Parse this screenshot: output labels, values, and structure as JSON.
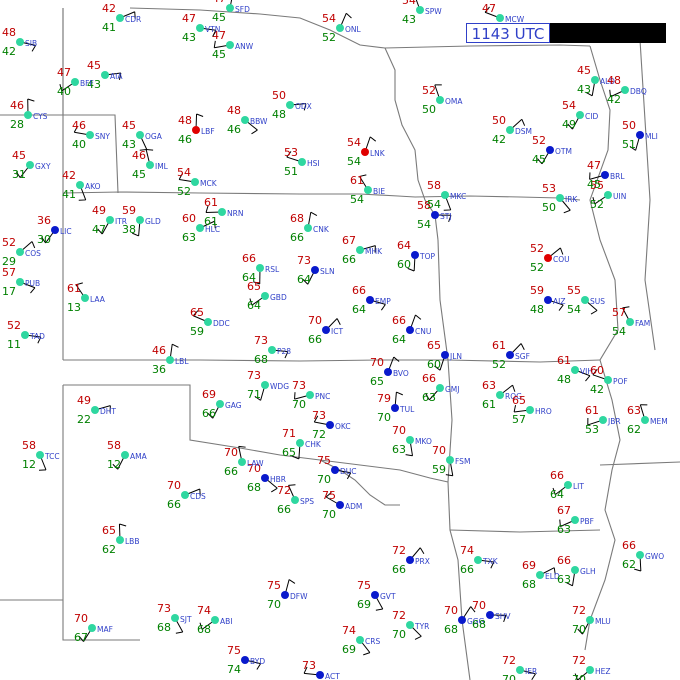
{
  "title_box": {
    "time": "1143 UTC"
  },
  "colors": {
    "temperature": "#c00000",
    "dewpoint": "#008000",
    "station_id": "#3040c8",
    "weather_symbol": "#b000b0",
    "borders": "#7a7a7a",
    "wind_barb": "#000000",
    "sky_clear": "#2fd7a0",
    "sky_overcast": "#0a1acc",
    "sky_thunder": "#e00000"
  },
  "stations": [
    {
      "id": "CDR",
      "t": "42",
      "td": "41",
      "sky": "clear"
    },
    {
      "id": "SFD",
      "t": "47",
      "td": "45",
      "sky": "clear"
    },
    {
      "id": "ANW",
      "t": "47",
      "td": "45",
      "sky": "clear"
    },
    {
      "id": "VTN",
      "t": "47",
      "td": "43",
      "sky": "clear"
    },
    {
      "id": "ONL",
      "t": "54",
      "td": "52",
      "sky": "clear"
    },
    {
      "id": "SIB",
      "t": "48",
      "td": "42",
      "sky": "clear"
    },
    {
      "id": "AIA",
      "t": "45",
      "td": "43",
      "sky": "clear"
    },
    {
      "id": "BFF",
      "t": "47",
      "td": "40",
      "sky": "clear"
    },
    {
      "id": "CYS",
      "t": "46",
      "td": "28",
      "sky": "clear"
    },
    {
      "id": "SNY",
      "t": "46",
      "td": "40",
      "sky": "clear"
    },
    {
      "id": "OGA",
      "t": "45",
      "td": "43",
      "sky": "clear"
    },
    {
      "id": "LBF",
      "t": "48",
      "td": "46",
      "sky": "thunder"
    },
    {
      "id": "BBW",
      "t": "48",
      "td": "46",
      "sky": "clear"
    },
    {
      "id": "ODX",
      "t": "50",
      "td": "48",
      "sky": "clear"
    },
    {
      "id": "IML",
      "t": "46",
      "td": "45",
      "sky": "clear"
    },
    {
      "id": "HSI",
      "t": "53",
      "td": "51",
      "sky": "clear"
    },
    {
      "id": "LNK",
      "t": "54",
      "td": "54",
      "sky": "thunder"
    },
    {
      "id": "GXY",
      "t": "45",
      "td": "31",
      "sky": "clear"
    },
    {
      "id": "MCK",
      "t": "54",
      "td": "52",
      "sky": "clear"
    },
    {
      "id": "AKO",
      "t": "42",
      "td": "41",
      "sky": "clear"
    },
    {
      "id": "LIC",
      "t": "36",
      "td": "30",
      "sky": "overcast"
    },
    {
      "id": "ITR",
      "t": "49",
      "td": "47",
      "sky": "clear"
    },
    {
      "id": "GLD",
      "t": "59",
      "td": "38",
      "sky": "clear"
    },
    {
      "id": "HLC",
      "t": "60",
      "td": "63",
      "sky": "clear"
    },
    {
      "id": "NRN",
      "t": "61",
      "td": "61",
      "sky": "clear"
    },
    {
      "id": "BIE",
      "t": "61",
      "td": "54",
      "sky": "clear"
    },
    {
      "id": "CNK",
      "t": "68",
      "td": "66",
      "sky": "clear"
    },
    {
      "id": "MHK",
      "t": "67",
      "td": "66",
      "sky": "clear"
    },
    {
      "id": "TOP",
      "t": "64",
      "td": "60",
      "sky": "overcast"
    },
    {
      "id": "STJ",
      "t": "58",
      "td": "54",
      "sky": "overcast"
    },
    {
      "id": "COS",
      "t": "52",
      "td": "29",
      "sky": "clear"
    },
    {
      "id": "PUB",
      "t": "57",
      "td": "17",
      "sky": "clear"
    },
    {
      "id": "LAA",
      "t": "61",
      "td": "13",
      "sky": "clear"
    },
    {
      "id": "TAD",
      "t": "52",
      "td": "11",
      "sky": "clear"
    },
    {
      "id": "SLN",
      "t": "73",
      "td": "64",
      "sky": "overcast"
    },
    {
      "id": "RSL",
      "t": "66",
      "td": "64",
      "sky": "clear"
    },
    {
      "id": "GBD",
      "t": "65",
      "td": "64",
      "sky": "clear"
    },
    {
      "id": "DDC",
      "t": "65",
      "td": "59",
      "sky": "clear"
    },
    {
      "id": "EMP",
      "t": "66",
      "td": "64",
      "sky": "overcast"
    },
    {
      "id": "ICT",
      "t": "70",
      "td": "66",
      "sky": "overcast"
    },
    {
      "id": "CNU",
      "t": "66",
      "td": "64",
      "sky": "overcast"
    },
    {
      "id": "LBL",
      "t": "46",
      "td": "36",
      "sky": "clear"
    },
    {
      "id": "P28",
      "t": "73",
      "td": "68",
      "sky": "clear"
    },
    {
      "id": "JLN",
      "t": "65",
      "td": "60",
      "sky": "overcast"
    },
    {
      "id": "SGF",
      "t": "61",
      "td": "52",
      "sky": "overcast"
    },
    {
      "id": "VIH",
      "t": "61",
      "td": "48",
      "sky": "clear"
    },
    {
      "id": "DHT",
      "t": "49",
      "td": "22",
      "sky": "clear"
    },
    {
      "id": "GAG",
      "t": "69",
      "td": "66",
      "sky": "clear"
    },
    {
      "id": "WDG",
      "t": "73",
      "td": "71",
      "sky": "clear"
    },
    {
      "id": "PNC",
      "t": "73",
      "td": "70",
      "sky": "clear"
    },
    {
      "id": "BVO",
      "t": "70",
      "td": "65",
      "sky": "overcast"
    },
    {
      "id": "GMJ",
      "t": "66",
      "td": "63",
      "sky": "clear"
    },
    {
      "id": "TUL",
      "t": "79",
      "td": "70",
      "sky": "overcast"
    },
    {
      "id": "OKC",
      "t": "73",
      "td": "72",
      "sky": "overcast"
    },
    {
      "id": "HBR",
      "t": "70",
      "td": "68",
      "sky": "overcast"
    },
    {
      "id": "MKO",
      "t": "70",
      "td": "63",
      "sky": "clear"
    },
    {
      "id": "FSM",
      "t": "70",
      "td": "59",
      "sky": "clear"
    },
    {
      "id": "ROG",
      "t": "63",
      "td": "61",
      "sky": "clear"
    },
    {
      "id": "HRO",
      "t": "65",
      "td": "57",
      "sky": "clear"
    },
    {
      "id": "CHK",
      "t": "71",
      "td": "65",
      "sky": "clear"
    },
    {
      "id": "LAW",
      "t": "70",
      "td": "66",
      "sky": "clear"
    },
    {
      "id": "SPS",
      "t": "72",
      "td": "66",
      "sky": "clear"
    },
    {
      "id": "DUC",
      "t": "75",
      "td": "70",
      "sky": "overcast"
    },
    {
      "id": "ADM",
      "t": "75",
      "td": "70",
      "sky": "overcast"
    },
    {
      "id": "PRX",
      "t": "72",
      "td": "66",
      "sky": "overcast"
    },
    {
      "id": "TXK",
      "t": "74",
      "td": "66",
      "sky": "clear"
    },
    {
      "id": "ELD",
      "t": "69",
      "td": "68",
      "sky": "clear"
    },
    {
      "id": "LIT",
      "t": "66",
      "td": "64",
      "sky": "clear"
    },
    {
      "id": "CDS",
      "t": "70",
      "td": "66",
      "sky": "clear"
    },
    {
      "id": "LBB",
      "t": "65",
      "td": "62",
      "sky": "clear"
    },
    {
      "id": "AMA",
      "t": "58",
      "td": "12",
      "sky": "clear"
    },
    {
      "id": "TCC",
      "t": "58",
      "td": "12",
      "sky": "clear"
    },
    {
      "id": "MAF",
      "t": "70",
      "td": "67",
      "sky": "clear"
    },
    {
      "id": "ABI",
      "t": "74",
      "td": "68",
      "sky": "clear"
    },
    {
      "id": "SJT",
      "t": "73",
      "td": "68",
      "sky": "clear"
    },
    {
      "id": "BYD",
      "t": "75",
      "td": "74",
      "sky": "overcast"
    },
    {
      "id": "DFW",
      "t": "75",
      "td": "70",
      "sky": "overcast"
    },
    {
      "id": "GVT",
      "t": "75",
      "td": "69",
      "sky": "overcast"
    },
    {
      "id": "TYR",
      "t": "72",
      "td": "70",
      "sky": "clear"
    },
    {
      "id": "GGG",
      "t": "70",
      "td": "68",
      "sky": "overcast"
    },
    {
      "id": "SHV",
      "t": "70",
      "td": "68",
      "sky": "overcast"
    },
    {
      "id": "MLU",
      "t": "72",
      "td": "70",
      "sky": "clear"
    },
    {
      "id": "CRS",
      "t": "74",
      "td": "69",
      "sky": "clear"
    },
    {
      "id": "ACT",
      "t": "73",
      "td": "71",
      "sky": "overcast"
    },
    {
      "id": "IER",
      "t": "72",
      "td": "70",
      "sky": "clear"
    },
    {
      "id": "HEZ",
      "t": "72",
      "td": "70",
      "sky": "clear"
    },
    {
      "id": "FAM",
      "t": "57",
      "td": "54",
      "sky": "clear"
    },
    {
      "id": "UIN",
      "t": "55",
      "td": "52",
      "sky": "clear"
    },
    {
      "id": "IRK",
      "t": "53",
      "td": "50",
      "sky": "clear"
    },
    {
      "id": "COU",
      "t": "52",
      "td": "52",
      "sky": "thunder"
    },
    {
      "id": "AIZ",
      "t": "59",
      "td": "48",
      "sky": "overcast"
    },
    {
      "id": "SUS",
      "t": "55",
      "td": "54",
      "sky": "clear"
    },
    {
      "id": "POF",
      "t": "60",
      "td": "42",
      "sky": "clear"
    },
    {
      "id": "MEM",
      "t": "63",
      "td": "62",
      "sky": "clear"
    },
    {
      "id": "JBR",
      "t": "61",
      "td": "53",
      "sky": "clear"
    },
    {
      "id": "PBF",
      "t": "67",
      "td": "63",
      "sky": "clear"
    },
    {
      "id": "GLH",
      "t": "66",
      "td": "63",
      "sky": "clear"
    },
    {
      "id": "GWO",
      "t": "66",
      "td": "62",
      "sky": "clear"
    },
    {
      "id": "MKC",
      "t": "58",
      "td": "54",
      "sky": "clear"
    },
    {
      "id": "OMA",
      "t": "52",
      "td": "50",
      "sky": "clear"
    },
    {
      "id": "DSM",
      "t": "50",
      "td": "42",
      "sky": "clear"
    },
    {
      "id": "SPW",
      "t": "54",
      "td": "43",
      "sky": "clear"
    },
    {
      "id": "MCW",
      "t": "47",
      "td": "42",
      "sky": "clear"
    },
    {
      "id": "ALO",
      "t": "45",
      "td": "43",
      "sky": "clear"
    },
    {
      "id": "DBQ",
      "t": "48",
      "td": "42",
      "sky": "clear"
    },
    {
      "id": "MLI",
      "t": "50",
      "td": "51",
      "sky": "overcast"
    },
    {
      "id": "BRL",
      "t": "47",
      "td": "45",
      "sky": "overcast"
    },
    {
      "id": "OTM",
      "t": "52",
      "td": "45",
      "sky": "overcast"
    },
    {
      "id": "CID",
      "t": "54",
      "td": "49",
      "sky": "clear"
    }
  ]
}
